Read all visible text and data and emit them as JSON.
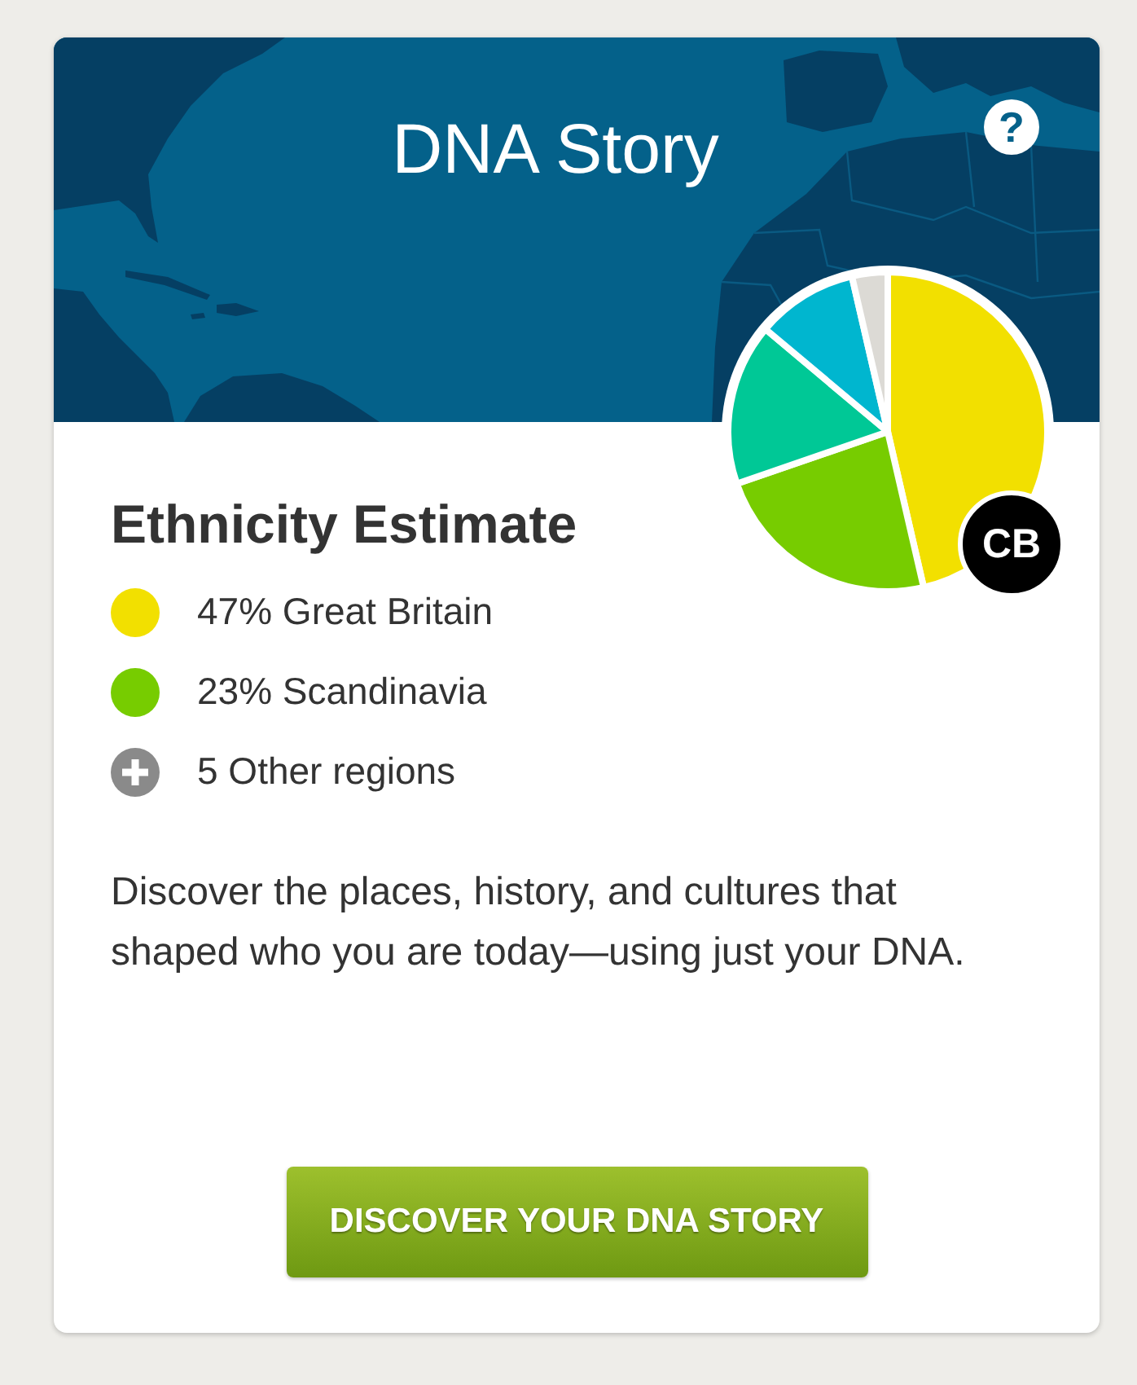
{
  "header": {
    "title": "DNA Story",
    "help_button": {
      "label": "?"
    }
  },
  "pie": {
    "slices": [
      {
        "color": "#f2e000"
      },
      {
        "color": "#77cc00"
      },
      {
        "color": "#00c896"
      },
      {
        "color": "#00b6cf"
      },
      {
        "color": "#dcdad5"
      }
    ]
  },
  "avatar": {
    "initials": "CB"
  },
  "section_title": "Ethnicity Estimate",
  "legend": [
    {
      "kind": "region",
      "label": "47% Great Britain",
      "color": "#f2e000"
    },
    {
      "kind": "region",
      "label": "23% Scandinavia",
      "color": "#77cc00"
    },
    {
      "kind": "more",
      "label": "5 Other regions"
    }
  ],
  "description": "Discover the places, history, and cultures that shaped who you are today—using just your DNA.",
  "button": {
    "label": "DISCOVER YOUR DNA STORY"
  }
}
